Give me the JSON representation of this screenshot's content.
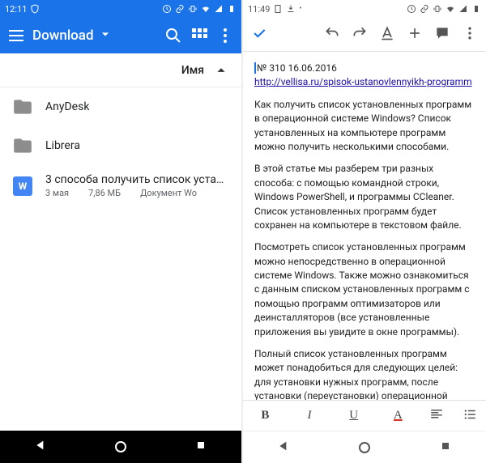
{
  "left": {
    "statusbar": {
      "time": "12:11"
    },
    "appbar": {
      "title": "Download"
    },
    "sort": {
      "label": "Имя"
    },
    "items": [
      {
        "kind": "folder",
        "name": "AnyDesk"
      },
      {
        "kind": "folder",
        "name": "Librera"
      },
      {
        "kind": "doc",
        "name": "3 способа получить список устано…",
        "date": "3 мая",
        "size": "7,86 МБ",
        "type": "Документ Wo"
      }
    ]
  },
  "right": {
    "statusbar": {
      "time": "11:49"
    },
    "doc": {
      "num": "№ 310 16.06.2016",
      "url_text": "http://vellisa.ru/spisok-ustanovlennyikh-programm",
      "p1": "Как получить список установленных программ в операционной системе Windows? Список установленных на компьютере программ можно получить несколькими способами.",
      "p2": "В этой статье мы разберем три разных способа: с помощью командной строки, Windows PowerShell, и программы CCleaner. Список установленных программ будет сохранен на компьютере в текстовом файле.",
      "p3": "Посмотреть список установленных программ можно непосредственно в операционной системе Windows. Также можно ознакомиться с данным списком установленных программ с помощью программ оптимизаторов или деинсталляторов (все установленные приложения вы увидите в окне программы).",
      "p4": "Полный список установленных программ может понадобиться для следующих целей: для установки нужных программ, после установки (переустановки) операционной системы Windows, после покупки нового компьютера для того, чтобы не забыть"
    },
    "fmt": {
      "b": "B",
      "i": "I",
      "u": "U",
      "a": "A"
    }
  }
}
